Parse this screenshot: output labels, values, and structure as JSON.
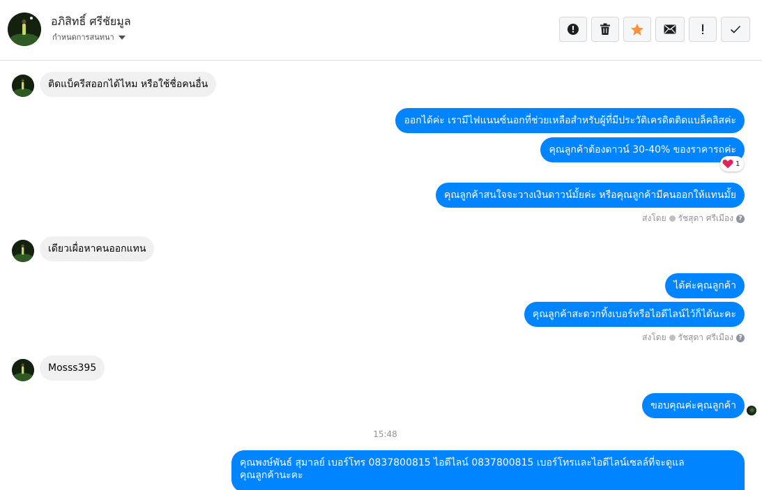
{
  "header": {
    "contact_name": "อภิสิทธิ์ ศรีชัยมูล",
    "conversation_setting": "กำหนดการสนทนา"
  },
  "toolbar": {
    "buttons": [
      {
        "icon": "alert-circle-icon",
        "label": "spam"
      },
      {
        "icon": "trash-icon",
        "label": "delete"
      },
      {
        "icon": "star-icon",
        "label": "star",
        "color": "#f7923a"
      },
      {
        "icon": "envelope-icon",
        "label": "mark unread"
      },
      {
        "icon": "exclamation-icon",
        "label": "follow up"
      },
      {
        "icon": "checkmark-icon",
        "label": "done"
      }
    ]
  },
  "messages": {
    "in_1": "ติดแบ็ครีสออกได้ไหม หรือใช้ชื่อคนอื่น",
    "out_1": "ออกได้ค่ะ เรามีไฟแนนซ์นอกที่ช่วยเหลือสำหรับผู้ที่มีประวัติเครดิตติดแบล็คลิสค่ะ",
    "out_2": "คุณลูกค้าต้องดาวน์ 30-40% ของราคารถค่ะ",
    "reaction_count": "1",
    "out_3": "คุณลูกค้าสนใจจะวางเงินดาวน์มั้ยค่ะ หรือคุณลูกค้ามีคนออกให้แทนมั้ย",
    "sent_by_label": "ส่งโดย",
    "sent_by_name": "รัชสุดา ศรีเมือง",
    "in_2": "เดียวเผื่อหาคนออกแทน",
    "out_4": "ได้ค่ะคุณลูกค้า",
    "out_5": "คุณลูกค้าสะดวกทิ้งเบอร์หรือไอดีไลน์ไว้ก็ได้นะคะ",
    "in_3": "Mosss395",
    "out_6": "ขอบคุณค่ะคุณลูกค้า",
    "timestamp": "15:48",
    "out_7_line1": "คุณพงษ์พันธ์ สุมาลย์      เบอร์โทร 0837800815  ไอดีไลน์ 0837800815  เบอร์โทรและไอดีไลน์เซลล์ที่จะดูแล",
    "out_7_line2": "คุณลูกค้านะคะ"
  },
  "colors": {
    "outgoing_bubble": "#0084ff",
    "incoming_bubble": "#f0f0f0",
    "reaction_heart": "#e0245e"
  }
}
